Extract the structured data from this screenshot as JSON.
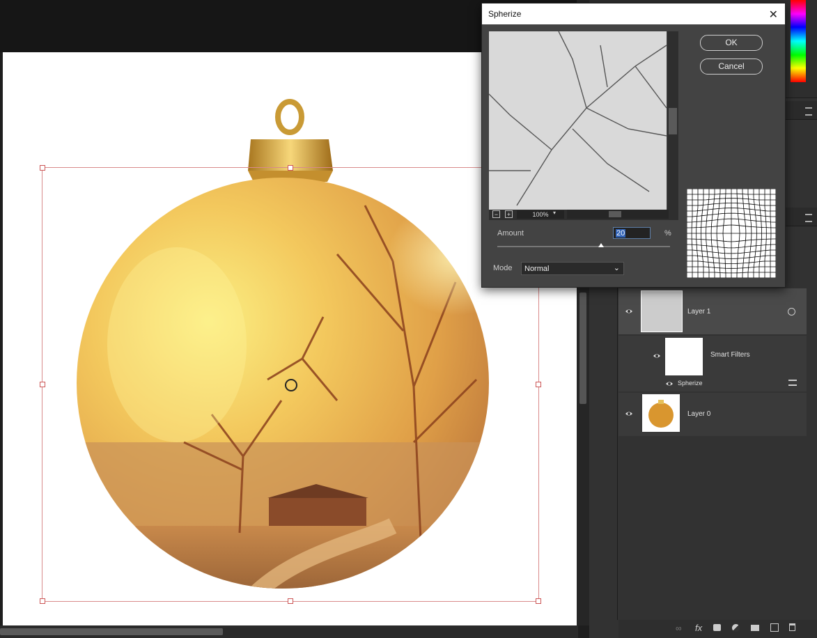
{
  "dialog": {
    "title": "Spherize",
    "ok_label": "OK",
    "cancel_label": "Cancel",
    "zoom": "100%",
    "zoom_out_symbol": "−",
    "zoom_in_symbol": "+",
    "amount_label": "Amount",
    "amount_value": "20",
    "amount_unit": "%",
    "amount_slider_fraction": 0.6,
    "mode_label": "Mode",
    "mode_value": "Normal"
  },
  "layers": {
    "items": [
      {
        "name": "Layer 1"
      },
      {
        "name": "Smart Filters"
      },
      {
        "name": "Spherize"
      },
      {
        "name": "Layer 0"
      }
    ]
  },
  "icons": {
    "close": "close-icon",
    "eye": "eye-icon",
    "link": "link-icon",
    "fx": "fx-icon",
    "mask": "mask-icon",
    "adjust": "adjustment-icon",
    "folder": "folder-icon",
    "new": "new-layer-icon",
    "trash": "trash-icon"
  },
  "footer": {
    "fx_label": "fx"
  },
  "colors": {
    "accent": "#2f62b7",
    "transform_box": "#d98a8a",
    "ornament_gold": "#e8b54a"
  }
}
